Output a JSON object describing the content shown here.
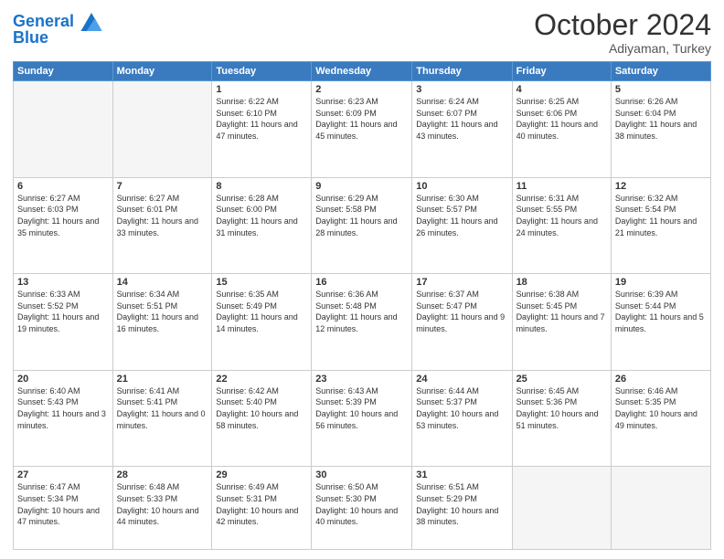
{
  "header": {
    "logo_line1": "General",
    "logo_line2": "Blue",
    "month": "October 2024",
    "location": "Adiyaman, Turkey"
  },
  "weekdays": [
    "Sunday",
    "Monday",
    "Tuesday",
    "Wednesday",
    "Thursday",
    "Friday",
    "Saturday"
  ],
  "weeks": [
    [
      {
        "day": "",
        "info": ""
      },
      {
        "day": "",
        "info": ""
      },
      {
        "day": "1",
        "info": "Sunrise: 6:22 AM\nSunset: 6:10 PM\nDaylight: 11 hours and 47 minutes."
      },
      {
        "day": "2",
        "info": "Sunrise: 6:23 AM\nSunset: 6:09 PM\nDaylight: 11 hours and 45 minutes."
      },
      {
        "day": "3",
        "info": "Sunrise: 6:24 AM\nSunset: 6:07 PM\nDaylight: 11 hours and 43 minutes."
      },
      {
        "day": "4",
        "info": "Sunrise: 6:25 AM\nSunset: 6:06 PM\nDaylight: 11 hours and 40 minutes."
      },
      {
        "day": "5",
        "info": "Sunrise: 6:26 AM\nSunset: 6:04 PM\nDaylight: 11 hours and 38 minutes."
      }
    ],
    [
      {
        "day": "6",
        "info": "Sunrise: 6:27 AM\nSunset: 6:03 PM\nDaylight: 11 hours and 35 minutes."
      },
      {
        "day": "7",
        "info": "Sunrise: 6:27 AM\nSunset: 6:01 PM\nDaylight: 11 hours and 33 minutes."
      },
      {
        "day": "8",
        "info": "Sunrise: 6:28 AM\nSunset: 6:00 PM\nDaylight: 11 hours and 31 minutes."
      },
      {
        "day": "9",
        "info": "Sunrise: 6:29 AM\nSunset: 5:58 PM\nDaylight: 11 hours and 28 minutes."
      },
      {
        "day": "10",
        "info": "Sunrise: 6:30 AM\nSunset: 5:57 PM\nDaylight: 11 hours and 26 minutes."
      },
      {
        "day": "11",
        "info": "Sunrise: 6:31 AM\nSunset: 5:55 PM\nDaylight: 11 hours and 24 minutes."
      },
      {
        "day": "12",
        "info": "Sunrise: 6:32 AM\nSunset: 5:54 PM\nDaylight: 11 hours and 21 minutes."
      }
    ],
    [
      {
        "day": "13",
        "info": "Sunrise: 6:33 AM\nSunset: 5:52 PM\nDaylight: 11 hours and 19 minutes."
      },
      {
        "day": "14",
        "info": "Sunrise: 6:34 AM\nSunset: 5:51 PM\nDaylight: 11 hours and 16 minutes."
      },
      {
        "day": "15",
        "info": "Sunrise: 6:35 AM\nSunset: 5:49 PM\nDaylight: 11 hours and 14 minutes."
      },
      {
        "day": "16",
        "info": "Sunrise: 6:36 AM\nSunset: 5:48 PM\nDaylight: 11 hours and 12 minutes."
      },
      {
        "day": "17",
        "info": "Sunrise: 6:37 AM\nSunset: 5:47 PM\nDaylight: 11 hours and 9 minutes."
      },
      {
        "day": "18",
        "info": "Sunrise: 6:38 AM\nSunset: 5:45 PM\nDaylight: 11 hours and 7 minutes."
      },
      {
        "day": "19",
        "info": "Sunrise: 6:39 AM\nSunset: 5:44 PM\nDaylight: 11 hours and 5 minutes."
      }
    ],
    [
      {
        "day": "20",
        "info": "Sunrise: 6:40 AM\nSunset: 5:43 PM\nDaylight: 11 hours and 3 minutes."
      },
      {
        "day": "21",
        "info": "Sunrise: 6:41 AM\nSunset: 5:41 PM\nDaylight: 11 hours and 0 minutes."
      },
      {
        "day": "22",
        "info": "Sunrise: 6:42 AM\nSunset: 5:40 PM\nDaylight: 10 hours and 58 minutes."
      },
      {
        "day": "23",
        "info": "Sunrise: 6:43 AM\nSunset: 5:39 PM\nDaylight: 10 hours and 56 minutes."
      },
      {
        "day": "24",
        "info": "Sunrise: 6:44 AM\nSunset: 5:37 PM\nDaylight: 10 hours and 53 minutes."
      },
      {
        "day": "25",
        "info": "Sunrise: 6:45 AM\nSunset: 5:36 PM\nDaylight: 10 hours and 51 minutes."
      },
      {
        "day": "26",
        "info": "Sunrise: 6:46 AM\nSunset: 5:35 PM\nDaylight: 10 hours and 49 minutes."
      }
    ],
    [
      {
        "day": "27",
        "info": "Sunrise: 6:47 AM\nSunset: 5:34 PM\nDaylight: 10 hours and 47 minutes."
      },
      {
        "day": "28",
        "info": "Sunrise: 6:48 AM\nSunset: 5:33 PM\nDaylight: 10 hours and 44 minutes."
      },
      {
        "day": "29",
        "info": "Sunrise: 6:49 AM\nSunset: 5:31 PM\nDaylight: 10 hours and 42 minutes."
      },
      {
        "day": "30",
        "info": "Sunrise: 6:50 AM\nSunset: 5:30 PM\nDaylight: 10 hours and 40 minutes."
      },
      {
        "day": "31",
        "info": "Sunrise: 6:51 AM\nSunset: 5:29 PM\nDaylight: 10 hours and 38 minutes."
      },
      {
        "day": "",
        "info": ""
      },
      {
        "day": "",
        "info": ""
      }
    ]
  ]
}
